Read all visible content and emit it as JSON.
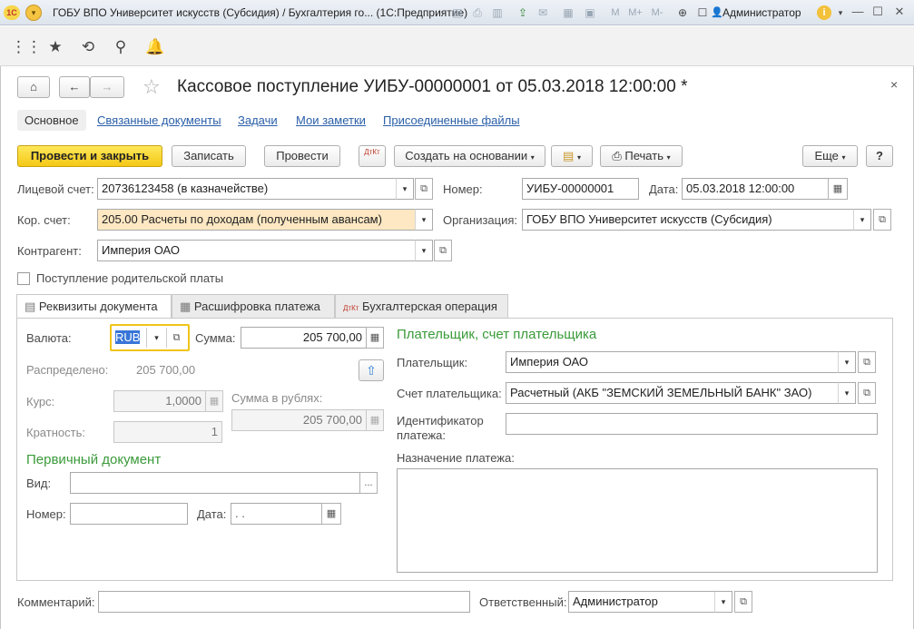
{
  "window": {
    "title": "ГОБУ ВПО Университет искусств (Субсидия) / Бухгалтерия го... (1С:Предприятие)",
    "user": "Администратор",
    "logo": "1С"
  },
  "document": {
    "title": "Кассовое поступление УИБУ-00000001 от 05.03.2018 12:00:00 *"
  },
  "tabs": [
    "Основное",
    "Связанные документы",
    "Задачи",
    "Мои заметки",
    "Присоединенные файлы"
  ],
  "toolbar": {
    "post_close": "Провести и закрыть",
    "save": "Записать",
    "post": "Провести",
    "dtkt": "ДтКт",
    "create_based": "Создать на основании",
    "print": "Печать",
    "more": "Еще",
    "help": "?"
  },
  "fields": {
    "account_label": "Лицевой счет:",
    "account_value": "20736123458 (в казначействе)",
    "number_label": "Номер:",
    "number_value": "УИБУ-00000001",
    "date_label": "Дата:",
    "date_value": "05.03.2018 12:00:00",
    "corr_label": "Кор. счет:",
    "corr_value": "205.00 Расчеты по доходам (полученным авансам)",
    "org_label": "Организация:",
    "org_value": "ГОБУ ВПО Университет искусств (Субсидия)",
    "contractor_label": "Контрагент:",
    "contractor_value": "Империя ОАО",
    "parent_fee_label": "Поступление родительской платы"
  },
  "page_tabs": [
    "Реквизиты документа",
    "Расшифровка платежа",
    "Бухгалтерская операция"
  ],
  "requisites": {
    "currency_label": "Валюта:",
    "currency_value": "RUB",
    "sum_label": "Сумма:",
    "sum_value": "205 700,00",
    "distributed_label": "Распределено:",
    "distributed_value": "205 700,00",
    "rate_label": "Курс:",
    "rate_value": "1,0000",
    "sum_rub_label": "Сумма в рублях:",
    "sum_rub_value": "205 700,00",
    "multiplicity_label": "Кратность:",
    "multiplicity_value": "1",
    "primary_doc_title": "Первичный документ",
    "kind_label": "Вид:",
    "doc_number_label": "Номер:",
    "doc_date_label": "Дата:",
    "doc_date_value": " .  .",
    "payer_section": "Плательщик, счет плательщика",
    "payer_label": "Плательщик:",
    "payer_value": "Империя ОАО",
    "payer_account_label": "Счет плательщика:",
    "payer_account_value": "Расчетный (АКБ \"ЗЕМСКИЙ ЗЕМЕЛЬНЫЙ БАНК\" ЗАО)",
    "payment_id_label": "Идентификатор платежа:",
    "purpose_label": "Назначение платежа:"
  },
  "footer": {
    "comment_label": "Комментарий:",
    "responsible_label": "Ответственный:",
    "responsible_value": "Администратор"
  },
  "colors": {
    "accent_yellow": "#f5c816",
    "section_green": "#3a9a3a",
    "link_blue": "#2a5fa8",
    "highlight": "#fde8c3"
  }
}
